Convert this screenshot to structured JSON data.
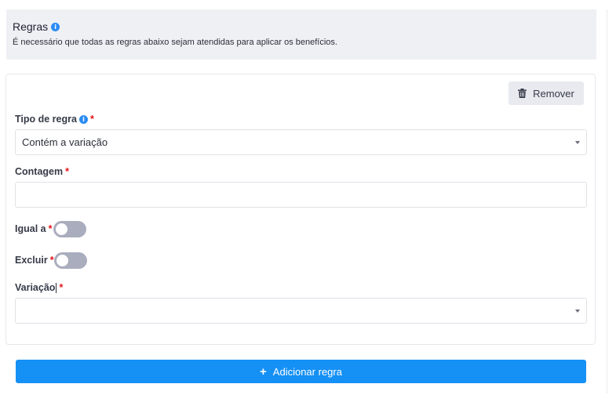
{
  "header": {
    "title": "Regras",
    "description": "É necessário que todas as regras abaixo sejam atendidas para aplicar os benefícios."
  },
  "rule": {
    "remove_label": "Remover",
    "rule_type": {
      "label": "Tipo de regra",
      "value": "Contém a variação"
    },
    "count": {
      "label": "Contagem",
      "value": ""
    },
    "equal_to": {
      "label": "Igual a",
      "enabled": false
    },
    "exclude": {
      "label": "Excluir",
      "enabled": false
    },
    "variation": {
      "label": "Variação",
      "value": ""
    },
    "required_mark": "*"
  },
  "add_rule_label": "Adicionar regra",
  "colors": {
    "accent": "#1590f5",
    "info": "#2b8cf4",
    "required": "#e3131a",
    "toggle_off": "#a9adbd"
  }
}
